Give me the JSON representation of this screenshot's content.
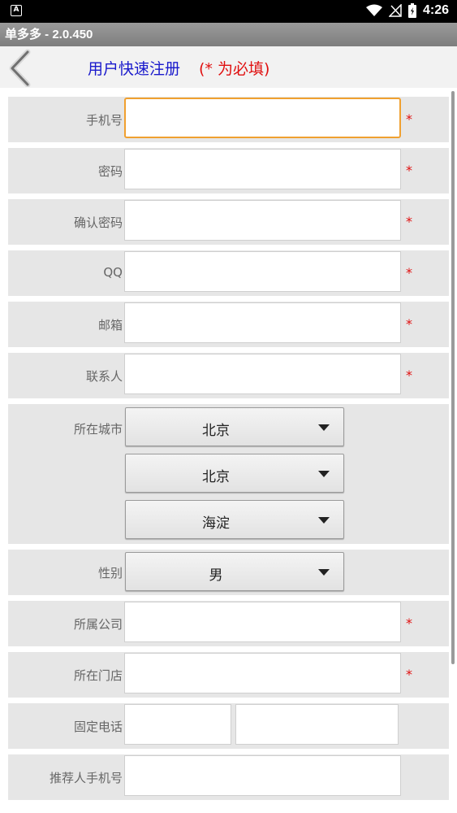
{
  "status_bar": {
    "app_badge": "A",
    "time": "4:26"
  },
  "app_title": "单多多 - 2.0.450",
  "header": {
    "title": "用户快速注册",
    "required_note": "(* 为必填)"
  },
  "required_mark": "*",
  "form": {
    "phone_label": "手机号",
    "password_label": "密码",
    "confirm_password_label": "确认密码",
    "qq_label": "QQ",
    "email_label": "邮箱",
    "contact_label": "联系人",
    "city_label": "所在城市",
    "province_value": "北京",
    "city_value": "北京",
    "district_value": "海淀",
    "gender_label": "性别",
    "gender_value": "男",
    "company_label": "所属公司",
    "store_label": "所在门店",
    "landline_label": "固定电话",
    "referrer_label": "推荐人手机号"
  }
}
